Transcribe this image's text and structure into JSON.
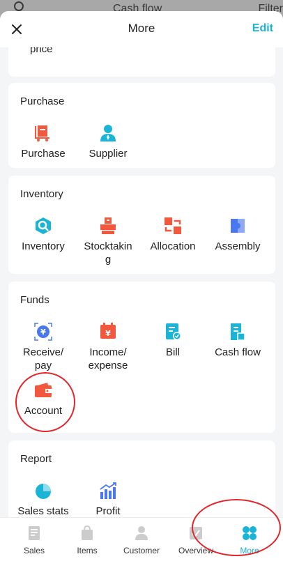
{
  "background_page": {
    "title": "Cash flow",
    "filter_label": "Filter"
  },
  "header": {
    "title": "More",
    "edit_label": "Edit"
  },
  "top_section": {
    "partial_label": "price"
  },
  "sections": {
    "purchase": {
      "title": "Purchase",
      "items": [
        {
          "label": "Purchase",
          "icon": "purchase-cart-icon",
          "color": "#f2583e"
        },
        {
          "label": "Supplier",
          "icon": "supplier-person-icon",
          "color": "#19b4d6"
        }
      ]
    },
    "inventory": {
      "title": "Inventory",
      "items": [
        {
          "label": "Inventory",
          "icon": "inventory-search-icon",
          "color": "#19b4d6"
        },
        {
          "label": "Stocktakin\ng",
          "icon": "stocktaking-boxes-icon",
          "color": "#f2583e"
        },
        {
          "label": "Allocation",
          "icon": "allocation-transfer-icon",
          "color": "#f2583e"
        },
        {
          "label": "Assembly",
          "icon": "assembly-puzzle-icon",
          "color": "#4a78f0"
        }
      ]
    },
    "funds": {
      "title": "Funds",
      "items": [
        {
          "label": "Receive/\npay",
          "icon": "receive-pay-yen-icon",
          "color": "#4a78f0"
        },
        {
          "label": "Income/\nexpense",
          "icon": "income-expense-yen-icon",
          "color": "#f2583e"
        },
        {
          "label": "Bill",
          "icon": "bill-document-icon",
          "color": "#19b4d6"
        },
        {
          "label": "Cash flow",
          "icon": "cash-flow-document-icon",
          "color": "#19b4d6"
        },
        {
          "label": "Account",
          "icon": "account-wallet-icon",
          "color": "#f2583e"
        }
      ]
    },
    "report": {
      "title": "Report",
      "items": [
        {
          "label": "Sales stats",
          "icon": "sales-stats-pie-icon",
          "color": "#19b4d6"
        },
        {
          "label": "Profit",
          "icon": "profit-bar-chart-icon",
          "color": "#4a78f0"
        }
      ]
    }
  },
  "tabbar": {
    "items": [
      {
        "label": "Sales",
        "icon": "sales-document-icon",
        "active": false
      },
      {
        "label": "Items",
        "icon": "items-bag-icon",
        "active": false
      },
      {
        "label": "Customer",
        "icon": "customer-person-icon",
        "active": false
      },
      {
        "label": "Overview",
        "icon": "overview-check-icon",
        "active": false
      },
      {
        "label": "More",
        "icon": "more-clover-icon",
        "active": true
      }
    ]
  },
  "colors": {
    "accent": "#19b4d6",
    "orange": "#f2583e",
    "blue": "#4a78f0",
    "annotation": "#e0262c",
    "inactive_icon": "#cccccc"
  }
}
